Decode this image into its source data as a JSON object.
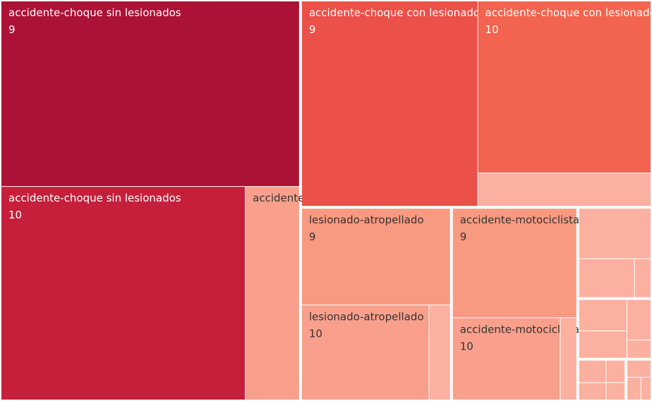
{
  "chart_data": {
    "type": "treemap",
    "colors": {
      "dark": "#ac1236",
      "crimson": "#c61f3c",
      "red": "#eb5049",
      "orange_red": "#f2644f",
      "salmon": "#f89a81",
      "light_salmon": "#f8a08c",
      "pale": "#fcb0a0",
      "text_light": "#ffffff",
      "text_dark": "#333333"
    },
    "groups": [
      {
        "name": "accidente-choque sin lesionados",
        "children": [
          {
            "label": "accidente-choque sin lesionados",
            "value_label": "9",
            "area": 108270,
            "color": "dark",
            "text": "light"
          },
          {
            "label": "accidente-choque sin lesionados",
            "value_label": "10",
            "area": 102000,
            "color": "crimson",
            "text": "light"
          },
          {
            "label": "accidente-choque sin lesionados",
            "value_label": "",
            "area": 22600,
            "color": "light_salmon",
            "text": "dark"
          }
        ]
      },
      {
        "name": "accidente-choque con lesionados",
        "children": [
          {
            "label": "accidente-choque con lesionados",
            "value_label": "9",
            "area": 71000,
            "color": "red",
            "text": "light"
          },
          {
            "label": "accidente-choque con lesionados",
            "value_label": "10",
            "area": 58500,
            "color": "orange_red",
            "text": "light"
          },
          {
            "label": "",
            "value_label": "",
            "area": 11300,
            "color": "pale",
            "text": "dark"
          }
        ]
      },
      {
        "name": "lesionado-atropellado",
        "children": [
          {
            "label": "lesionado-atropellado",
            "value_label": "9",
            "area": 28500,
            "color": "salmon",
            "text": "dark"
          },
          {
            "label": "lesionado-atropellado",
            "value_label": "10",
            "area": 24000,
            "color": "light_salmon",
            "text": "dark"
          },
          {
            "label": "",
            "value_label": "",
            "area": 4000,
            "color": "pale",
            "text": "dark"
          }
        ]
      },
      {
        "name": "accidente-motociclista",
        "children": [
          {
            "label": "accidente-motociclista",
            "value_label": "9",
            "area": 27000,
            "color": "salmon",
            "text": "dark"
          },
          {
            "label": "accidente-motociclista",
            "value_label": "10",
            "area": 17600,
            "color": "light_salmon",
            "text": "dark"
          },
          {
            "label": "",
            "value_label": "",
            "area": 2700,
            "color": "pale",
            "text": "dark"
          }
        ]
      },
      {
        "name": "",
        "children": [
          {
            "label": "",
            "value_label": "",
            "area": 7400,
            "color": "pale",
            "text": "dark"
          },
          {
            "label": "",
            "value_label": "",
            "area": 4400,
            "color": "pale",
            "text": "dark"
          },
          {
            "label": "",
            "value_label": "",
            "area": 1300,
            "color": "pale",
            "text": "dark"
          }
        ]
      },
      {
        "name": "",
        "children": [
          {
            "label": "",
            "value_label": "",
            "area": 3100,
            "color": "pale",
            "text": "dark"
          },
          {
            "label": "",
            "value_label": "",
            "area": 2700,
            "color": "pale",
            "text": "dark"
          },
          {
            "label": "",
            "value_label": "",
            "area": 2000,
            "color": "pale",
            "text": "dark"
          },
          {
            "label": "",
            "value_label": "",
            "area": 900,
            "color": "pale",
            "text": "dark"
          }
        ]
      },
      {
        "name": "",
        "children": [
          {
            "label": "",
            "value_label": "",
            "area": 1300,
            "color": "pale",
            "text": "dark"
          },
          {
            "label": "",
            "value_label": "",
            "area": 1000,
            "color": "pale",
            "text": "dark"
          },
          {
            "label": "",
            "value_label": "",
            "area": 900,
            "color": "pale",
            "text": "dark"
          },
          {
            "label": "",
            "value_label": "",
            "area": 700,
            "color": "pale",
            "text": "dark"
          }
        ]
      },
      {
        "name": "",
        "children": [
          {
            "label": "",
            "value_label": "",
            "area": 900,
            "color": "pale",
            "text": "dark"
          },
          {
            "label": "",
            "value_label": "",
            "area": 700,
            "color": "pale",
            "text": "dark"
          },
          {
            "label": "",
            "value_label": "",
            "area": 500,
            "color": "pale",
            "text": "dark"
          }
        ]
      }
    ]
  }
}
